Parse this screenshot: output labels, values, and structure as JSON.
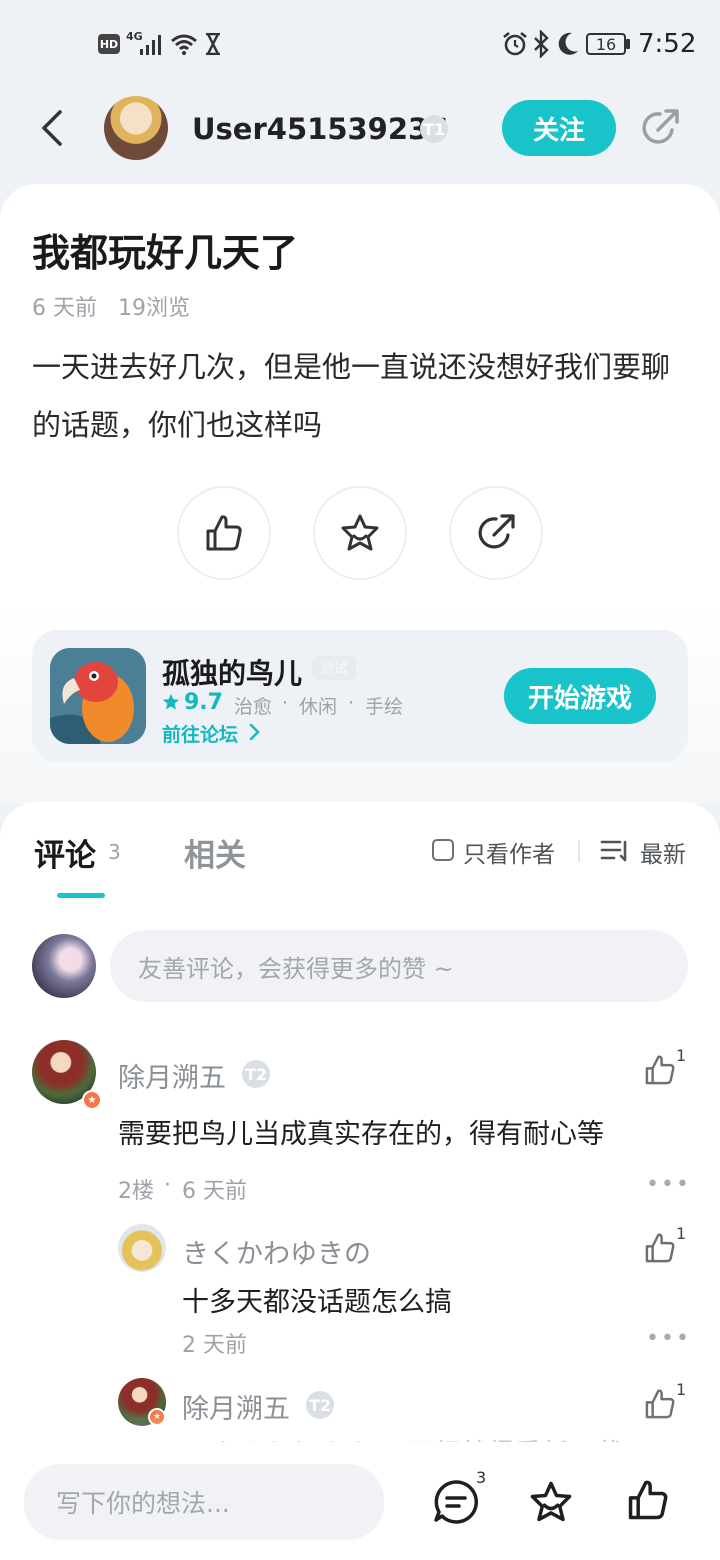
{
  "status": {
    "network": "HD",
    "signal_label": "4G",
    "battery": "16",
    "time": "7:52"
  },
  "header": {
    "username": "User451539236",
    "level": "T1",
    "follow": "关注"
  },
  "post": {
    "title": "我都玩好几天了",
    "meta_time": "6 天前",
    "meta_views": "19浏览",
    "body": "一天进去好几次，但是他一直说还没想好我们要聊的话题，你们也这样吗"
  },
  "game": {
    "name": "孤独的鸟儿",
    "tag": "测试",
    "rating": "9.7",
    "genres": [
      "治愈",
      "休闲",
      "手绘"
    ],
    "forum_link": "前往论坛",
    "play": "开始游戏"
  },
  "tabs": {
    "comments": "评论",
    "comments_count": "3",
    "related": "相关",
    "author_only": "只看作者",
    "sort": "最新"
  },
  "comment_input": {
    "placeholder": "友善评论，会获得更多的赞 ~"
  },
  "comments": [
    {
      "author": "除月溯五",
      "level": "T2",
      "text": "需要把鸟儿当成真实存在的，得有耐心等",
      "floor": "2楼",
      "time": "6 天前",
      "likes": "1"
    },
    {
      "author": "きくかわゆきの",
      "text": "十多天都没话题怎么搞",
      "time": "2 天前",
      "likes": "1"
    },
    {
      "author": "除月溯五",
      "level": "T2",
      "text": "@きくかわゆきの 不行就得重新下载了",
      "likes": "1"
    }
  ],
  "bottom": {
    "placeholder": "写下你的想法...",
    "comment_count": "3"
  },
  "colors": {
    "accent": "#18c4c9",
    "background": "#eef1f5"
  }
}
